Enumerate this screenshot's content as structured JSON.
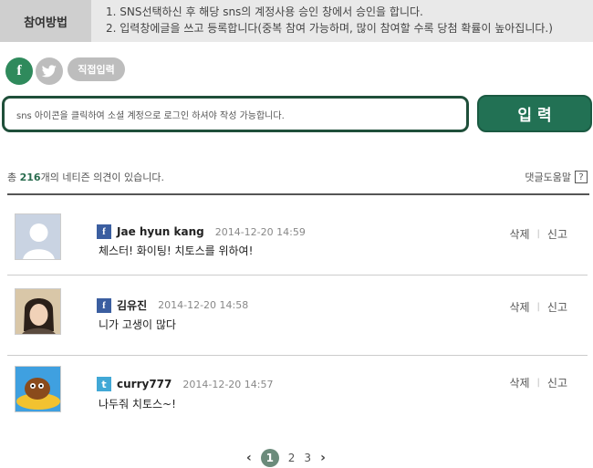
{
  "howto": {
    "label": "참여방법",
    "line1": "1. SNS선택하신 후 해당 sns의 계정사용 승인 창에서 승인을 합니다.",
    "line2": "2. 입력창에글을 쓰고 등록합니다(중복 참여 가능하며, 많이 참여할 수록 당첨 확률이 높아집니다.)"
  },
  "sns": {
    "facebook_glyph": "f",
    "twitter_glyph": "🐦",
    "direct_label": "직접입력"
  },
  "form": {
    "placeholder": "sns 아이콘을 클릭하여 소셜 계정으로 로그인 하셔야 작성 가능합니다.",
    "submit_label": "입 력"
  },
  "summary": {
    "prefix": "총 ",
    "count": "216",
    "suffix": "개의 네티즌 의견이 있습니다.",
    "help_label": "댓글도움말",
    "help_glyph": "?"
  },
  "comments": [
    {
      "network": "facebook",
      "network_glyph": "f",
      "name": "Jae hyun kang",
      "date": "2014-12-20 14:59",
      "text": "체스터! 화이팅! 치토스를 위하여!",
      "delete": "삭제",
      "report": "신고"
    },
    {
      "network": "facebook",
      "network_glyph": "f",
      "name": "김유진",
      "date": "2014-12-20 14:58",
      "text": "니가 고생이 많다",
      "delete": "삭제",
      "report": "신고"
    },
    {
      "network": "twitter",
      "network_glyph": "t",
      "name": "curry777",
      "date": "2014-12-20 14:57",
      "text": "나두줘 치토스~!",
      "delete": "삭제",
      "report": "신고"
    }
  ],
  "pager": {
    "prev": "‹",
    "pages": [
      "1",
      "2",
      "3"
    ],
    "next": "›",
    "current": "1"
  },
  "colors": {
    "accent": "#227154",
    "facebook": "#3b5ea0",
    "twitter": "#41a8d6"
  }
}
